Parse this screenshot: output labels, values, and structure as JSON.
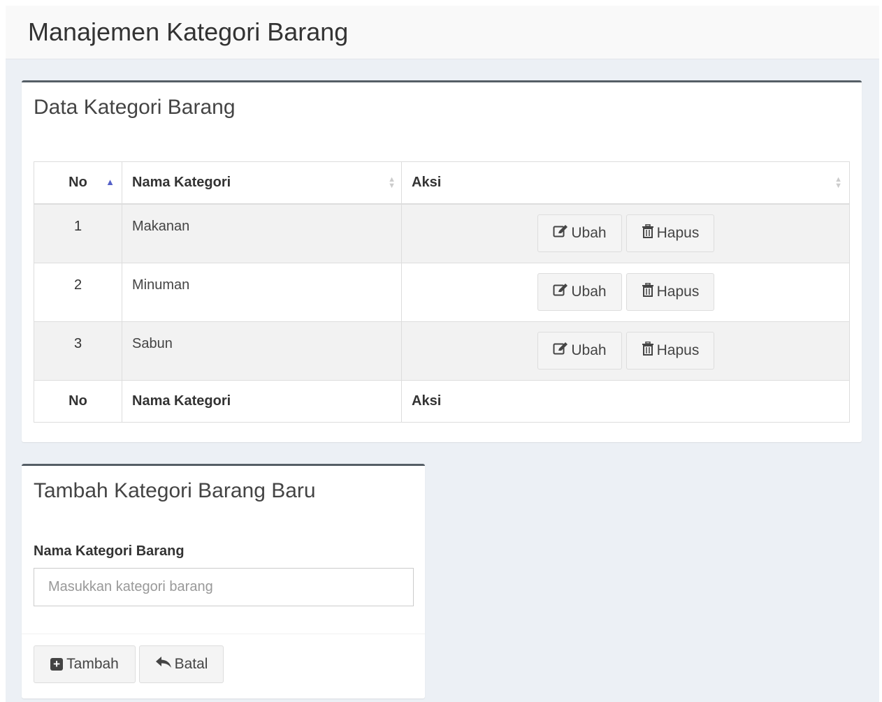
{
  "page": {
    "title": "Manajemen Kategori Barang"
  },
  "table_box": {
    "title": "Data Kategori Barang",
    "columns": [
      "No",
      "Nama Kategori",
      "Aksi"
    ],
    "footer_columns": [
      "No",
      "Nama Kategori",
      "Aksi"
    ],
    "rows": [
      {
        "no": "1",
        "name": "Makanan",
        "edit_label": "Ubah",
        "delete_label": "Hapus"
      },
      {
        "no": "2",
        "name": "Minuman",
        "edit_label": "Ubah",
        "delete_label": "Hapus"
      },
      {
        "no": "3",
        "name": "Sabun",
        "edit_label": "Ubah",
        "delete_label": "Hapus"
      }
    ],
    "icons": {
      "sort_active": "sort-ascending-icon",
      "sort_inactive": "sort-both-icon",
      "edit": "edit-icon",
      "delete": "trash-icon"
    }
  },
  "form_box": {
    "title": "Tambah Kategori Barang Baru",
    "field_label": "Nama Kategori Barang",
    "field_placeholder": "Masukkan kategori barang",
    "field_value": "",
    "add_label": "Tambah",
    "cancel_label": "Batal",
    "icons": {
      "add": "plus-square-icon",
      "cancel": "reply-icon"
    }
  },
  "colors": {
    "box_border_top": "#555e66",
    "background": "#ecf0f5",
    "sort_active": "#5561c8"
  }
}
